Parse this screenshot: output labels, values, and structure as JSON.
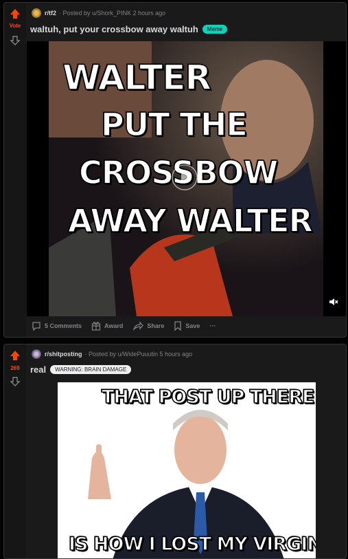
{
  "posts": [
    {
      "vote_label": "Vote",
      "subreddit": "r/tf2",
      "posted_by": "· Posted by u/Shork_PINK 2 hours ago",
      "title": "waltuh, put your crossbow away waltuh",
      "flair": "Meme",
      "flair_color": "#0dd3bb",
      "image_caption_lines": [
        "WALTER",
        "PUT THE",
        "CROSSBOW",
        "AWAY WALTER"
      ],
      "actions": {
        "comments": "5 Comments",
        "award": "Award",
        "share": "Share",
        "save": "Save",
        "more": "···"
      }
    },
    {
      "vote_label": "269",
      "subreddit": "r/shitposting",
      "posted_by": "· Posted by u/WidePuuutin 5 hours ago",
      "title": "real",
      "flair": "WARNING: BRAIN DAMAGE",
      "flair_color": "#edeff1",
      "image_caption_top": "THAT POST UP THERE",
      "image_caption_bottom": "IS HOW I LOST MY VIRGINITY"
    }
  ],
  "colors": {
    "upvote": "#ff4500",
    "background": "#030303",
    "card": "#1a1a1b"
  }
}
